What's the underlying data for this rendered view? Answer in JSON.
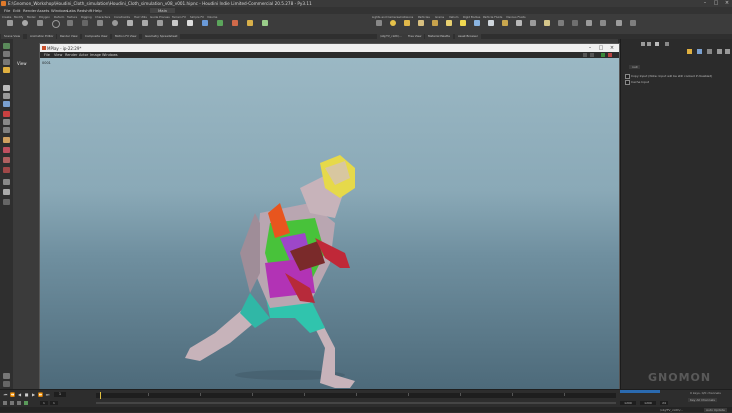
{
  "window": {
    "title": "E:\\Gnomon_Workshop\\Houdini_Cloth_simulation\\Houdini_Cloth_simulation_v08_v001.hipnc - Houdini Indie Limited-Commercial 20.5.278 - Py3.11"
  },
  "menubar": {
    "items": [
      "File",
      "Edit",
      "Render",
      "Assets",
      "Windows",
      "Labs",
      "Redshift",
      "Help"
    ],
    "build_label": "Main"
  },
  "shelf": {
    "tabs": [
      "Create",
      "Modify",
      "Model",
      "Polygon",
      "Deform",
      "Texture",
      "Rigging",
      "Characters",
      "Constraints",
      "Hair Utils",
      "Guide Process",
      "Terrain FX",
      "Simple FX",
      "Volume"
    ],
    "right_tabs": [
      "Lights and Cameras",
      "Collisions",
      "Particles",
      "Grains",
      "Vellum",
      "Rigid Bodies",
      "Particle Fluids",
      "Viscous Fluids"
    ]
  },
  "panetabs": {
    "left": [
      "Scene View",
      "Animation Editor",
      "Render View",
      "Composite View",
      "Motion FX View",
      "Geometry Spreadsheet"
    ],
    "right": [
      "/obj/TV_cloth/...",
      "Tree View",
      "Material Palette",
      "Asset Browser"
    ]
  },
  "viewer": {
    "view_label": "View"
  },
  "mplay": {
    "title": "MPlay - ip-22:29*",
    "menu": [
      "File",
      "View",
      "Render",
      "Actor",
      "Image",
      "Windows"
    ],
    "frame_info": "0001"
  },
  "rightpanel": {
    "node_label": "null",
    "option1": "Copy Input (Note: Input will be still cooked if disabled)",
    "option2": "Cache Input"
  },
  "timeline": {
    "current_frame": "1",
    "start_frame": "1",
    "end_frame": "1",
    "range_end": "1200",
    "range_end2": "1200",
    "fps_label": "24",
    "auto_update": "Auto Update",
    "keys_label": "0 keys, 0/0 channels",
    "key_all_label": "Key All Channels"
  },
  "status": {
    "path": "/obj/TV_cloth/..."
  },
  "watermark": "GNOMON",
  "colors": {
    "accent": "#e07a2a",
    "view_sky": "#9bb8c4",
    "view_floor": "#4d6a7a"
  }
}
